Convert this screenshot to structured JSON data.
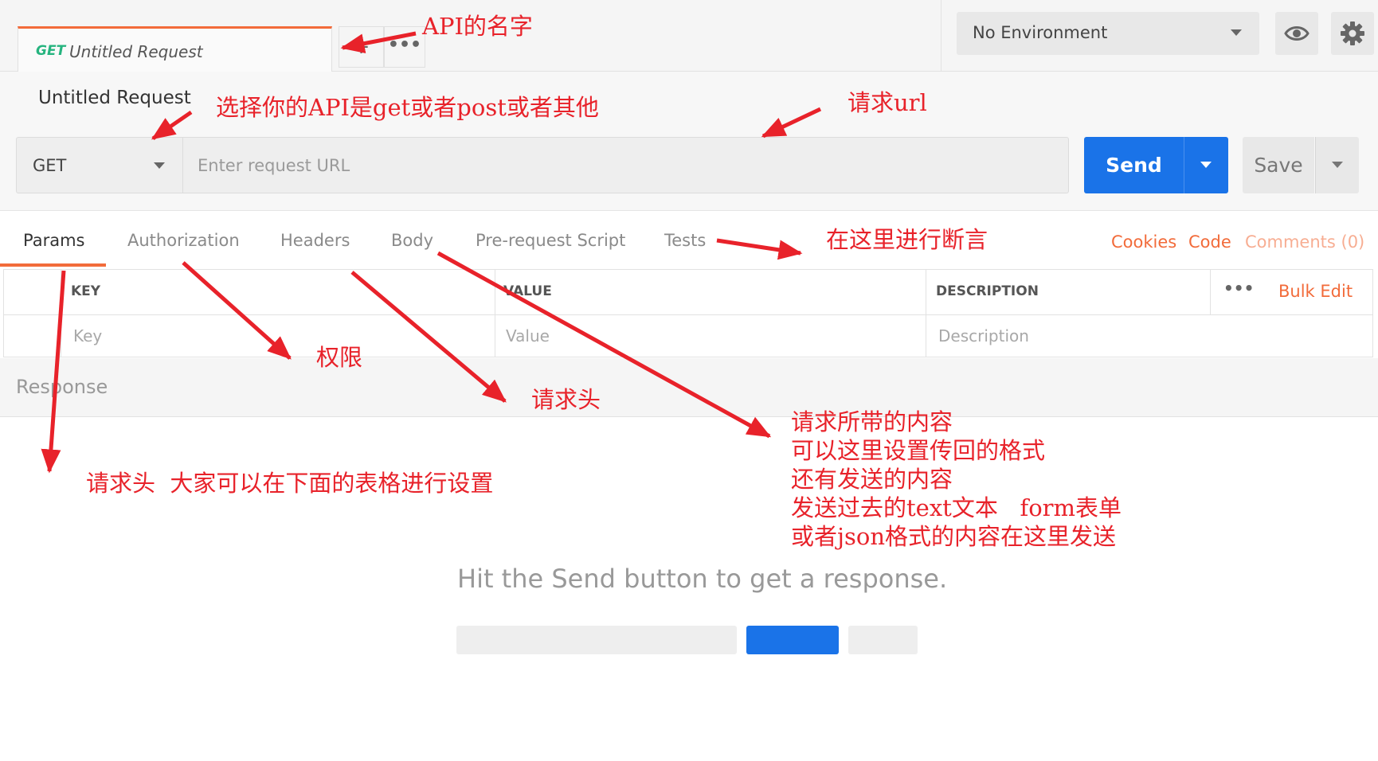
{
  "tab": {
    "method": "GET",
    "name": "Untitled Request",
    "new_tab": "+",
    "menu": "•••"
  },
  "environment": {
    "selected": "No Environment"
  },
  "request": {
    "title": "Untitled Request",
    "method": "GET",
    "url_placeholder": "Enter request URL",
    "send_label": "Send",
    "save_label": "Save"
  },
  "subtabs": [
    "Params",
    "Authorization",
    "Headers",
    "Body",
    "Pre-request Script",
    "Tests"
  ],
  "links": {
    "cookies": "Cookies",
    "code": "Code",
    "comments": "Comments (0)"
  },
  "table": {
    "headers": {
      "key": "KEY",
      "value": "VALUE",
      "description": "DESCRIPTION"
    },
    "more": "•••",
    "bulk_edit": "Bulk Edit",
    "row": {
      "key": "Key",
      "value": "Value",
      "description": "Description"
    }
  },
  "response": {
    "label": "Response",
    "hint": "Hit the Send button to get a response."
  },
  "annotations": {
    "api_name": "API的名字",
    "method": "选择你的API是get或者post或者其他",
    "url": "请求url",
    "assert": "在这里进行断言",
    "auth": "权限",
    "headers": "请求头",
    "params": "请求头  大家可以在下面的表格进行设置",
    "body": [
      "请求所带的内容",
      "可以这里设置传回的格式",
      "还有发送的内容",
      "发送过去的text文本   form表单",
      "或者json格式的内容在这里发送"
    ]
  },
  "colors": {
    "accent": "#f26b3a",
    "primary": "#1a73e8",
    "annotation": "#e8222a",
    "method_green": "#26b47f"
  },
  "icons": [
    "caret-down-icon",
    "eye-icon",
    "gear-icon",
    "plus-icon",
    "more-icon",
    "annotation-arrow-icon"
  ]
}
